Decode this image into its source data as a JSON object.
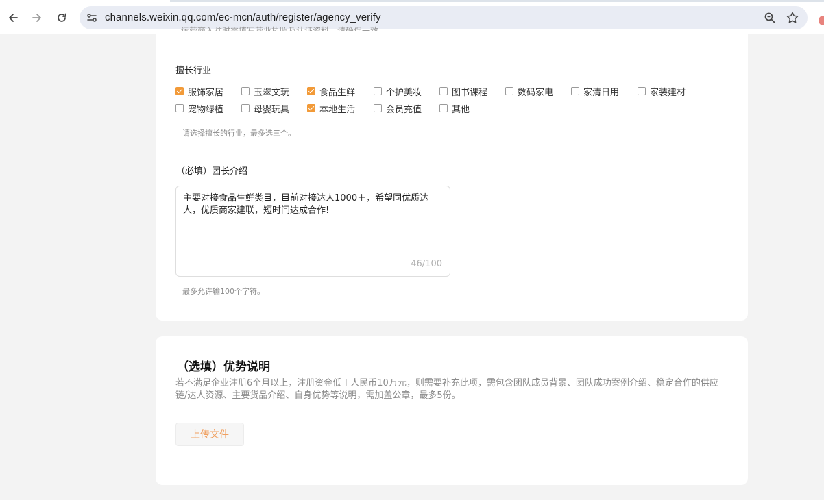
{
  "browser": {
    "url": "channels.weixin.qq.com/ec-mcn/auth/register/agency_verify",
    "back_icon": "back-arrow-icon",
    "forward_icon": "forward-arrow-icon",
    "reload_icon": "reload-icon",
    "site_info_icon": "tune-icon",
    "zoom_icon": "zoom-icon",
    "bookmark_icon": "star-icon"
  },
  "form": {
    "cutoff_text": "运营商入驻时需填写营业执照及认证资料，请确保一致",
    "industry": {
      "label": "擅长行业",
      "options": [
        {
          "label": "服饰家居",
          "checked": true
        },
        {
          "label": "玉翠文玩",
          "checked": false
        },
        {
          "label": "食品生鲜",
          "checked": true
        },
        {
          "label": "个护美妆",
          "checked": false
        },
        {
          "label": "图书课程",
          "checked": false
        },
        {
          "label": "数码家电",
          "checked": false
        },
        {
          "label": "家清日用",
          "checked": false
        },
        {
          "label": "家装建材",
          "checked": false
        },
        {
          "label": "宠物绿植",
          "checked": false
        },
        {
          "label": "母婴玩具",
          "checked": false
        },
        {
          "label": "本地生活",
          "checked": true
        },
        {
          "label": "会员充值",
          "checked": false
        },
        {
          "label": "其他",
          "checked": false
        }
      ],
      "hint": "请选择擅长的行业，最多选三个。"
    },
    "intro": {
      "label": "（必填）团长介绍",
      "value": "主要对接食品生鲜类目，目前对接达人1000＋，希望同优质达人，优质商家建联，短时间达成合作!",
      "counter": "46/100",
      "hint": "最多允许输100个字符。"
    }
  },
  "advantage": {
    "title": "（选填）优势说明",
    "description": "若不满足企业注册6个月以上，注册资金低于人民币10万元，则需要补充此项，需包含团队成员背景、团队成功案例介绍、稳定合作的供应链/达人资源、主要货品介绍、自身优势等说明，需加盖公章，最多5份。",
    "upload_label": "上传文件"
  },
  "colors": {
    "accent": "#f29a38",
    "upload_text": "#f0a060",
    "page_bg": "#f3f3f3"
  }
}
